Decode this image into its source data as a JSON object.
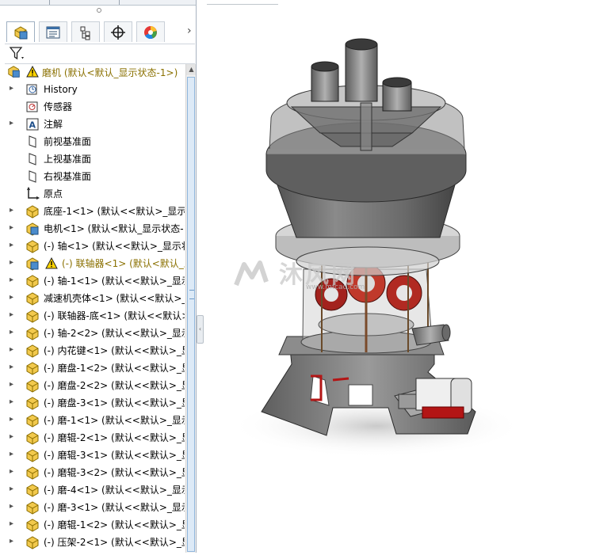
{
  "panel": {
    "tabs": [
      {
        "icon": "feature-manager-icon"
      },
      {
        "icon": "property-manager-icon"
      },
      {
        "icon": "configuration-manager-icon"
      },
      {
        "icon": "dimxpert-icon"
      },
      {
        "icon": "display-manager-icon"
      }
    ],
    "root": {
      "label": "磨机 (默认<默认_显示状态-1>)"
    },
    "items": [
      {
        "label": "History",
        "icon": "history-icon",
        "expand": true
      },
      {
        "label": "传感器",
        "icon": "sensor-icon",
        "expand": false
      },
      {
        "label": "注解",
        "icon": "annotation-icon",
        "expand": true
      },
      {
        "label": "前视基准面",
        "icon": "plane-icon",
        "expand": false
      },
      {
        "label": "上视基准面",
        "icon": "plane-icon",
        "expand": false
      },
      {
        "label": "右视基准面",
        "icon": "plane-icon",
        "expand": false
      },
      {
        "label": "原点",
        "icon": "origin-icon",
        "expand": false
      },
      {
        "label": "底座-1<1> (默认<<默认>_显示状",
        "icon": "part-icon",
        "expand": true
      },
      {
        "label": "电机<1> (默认<默认_显示状态-1",
        "icon": "assembly-icon",
        "expand": true
      },
      {
        "label": "(-) 轴<1> (默认<<默认>_显示状",
        "icon": "part-icon",
        "expand": true
      },
      {
        "label": "(-) 联轴器<1> (默认<默认_显",
        "icon": "assembly-icon",
        "expand": true,
        "warning": true
      },
      {
        "label": "(-) 轴-1<1> (默认<<默认>_显示",
        "icon": "part-icon",
        "expand": true
      },
      {
        "label": "减速机壳体<1> (默认<<默认>_显",
        "icon": "part-icon",
        "expand": true
      },
      {
        "label": "(-) 联轴器-底<1> (默认<<默认>",
        "icon": "part-icon",
        "expand": true
      },
      {
        "label": "(-) 轴-2<2> (默认<<默认>_显示",
        "icon": "part-icon",
        "expand": true
      },
      {
        "label": "(-) 内花键<1> (默认<<默认>_显",
        "icon": "part-icon",
        "expand": true
      },
      {
        "label": "(-) 磨盘-1<2> (默认<<默认>_显",
        "icon": "part-icon",
        "expand": true
      },
      {
        "label": "(-) 磨盘-2<2> (默认<<默认>_显",
        "icon": "part-icon",
        "expand": true
      },
      {
        "label": "(-) 磨盘-3<1> (默认<<默认>_显",
        "icon": "part-icon",
        "expand": true
      },
      {
        "label": "(-) 磨-1<1> (默认<<默认>_显示",
        "icon": "part-icon",
        "expand": true
      },
      {
        "label": "(-) 磨辊-2<1> (默认<<默认>_显",
        "icon": "part-icon",
        "expand": true
      },
      {
        "label": "(-) 磨辊-3<1> (默认<<默认>_显",
        "icon": "part-icon",
        "expand": true
      },
      {
        "label": "(-) 磨辊-3<2> (默认<<默认>_显",
        "icon": "part-icon",
        "expand": true
      },
      {
        "label": "(-) 磨-4<1> (默认<<默认>_显示",
        "icon": "part-icon",
        "expand": true
      },
      {
        "label": "(-) 磨-3<1> (默认<<默认>_显示",
        "icon": "part-icon",
        "expand": true
      },
      {
        "label": "(-) 磨辊-1<2> (默认<<默认>_显",
        "icon": "part-icon",
        "expand": true
      },
      {
        "label": "(-) 压架-2<1> (默认<<默认>_显",
        "icon": "part-icon",
        "expand": true
      }
    ]
  },
  "watermark": {
    "text": "沐风网",
    "url": "www.mfcad.com"
  },
  "colors": {
    "warning_text": "#8a7000",
    "part_yellow": "#f2c94c",
    "scroll_blue": "#8fb6dc"
  }
}
